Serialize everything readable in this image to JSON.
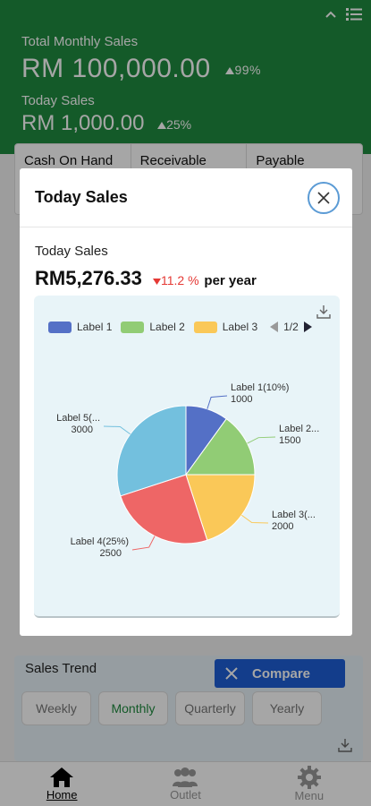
{
  "header": {
    "total_label": "Total Monthly Sales",
    "total_value": "RM 100,000.00",
    "total_delta": "99%",
    "today_label": "Today Sales",
    "today_value": "RM 1,000.00",
    "today_delta": "25%",
    "icons": [
      "chevron-up-icon",
      "menu-list-icon"
    ]
  },
  "stats": {
    "cash_on_hand": "Cash On Hand",
    "receivable": "Receivable",
    "payable": "Payable"
  },
  "modal": {
    "title": "Today Sales",
    "subtitle": "Today Sales",
    "amount": "RM5,276.33",
    "change": "11.2 %",
    "change_suffix": "per year",
    "legend_page": "1/2"
  },
  "chart_data": {
    "type": "pie",
    "title": "",
    "slices": [
      {
        "label": "Label 1",
        "display": "Label 1(10%)",
        "value": 1000,
        "color": "#5470c6"
      },
      {
        "label": "Label 2",
        "display": "Label 2...",
        "value": 1500,
        "color": "#91cc75"
      },
      {
        "label": "Label 3",
        "display": "Label 3(...",
        "value": 2000,
        "color": "#fac858"
      },
      {
        "label": "Label 4",
        "display": "Label 4(25%)",
        "value": 2500,
        "color": "#ee6666"
      },
      {
        "label": "Label 5",
        "display": "Label 5(...",
        "value": 3000,
        "color": "#73c0de"
      }
    ],
    "legend": [
      "Label 1",
      "Label 2",
      "Label 3"
    ],
    "legend_position": "top"
  },
  "trend": {
    "title": "Sales Trend",
    "compare_label": "Compare",
    "periods": [
      "Weekly",
      "Monthly",
      "Quarterly",
      "Yearly"
    ],
    "active_period": "Monthly"
  },
  "nav": {
    "items": [
      "Home",
      "Outlet",
      "Menu"
    ],
    "active": "Home"
  },
  "colors": {
    "header_green": "#1f8a3f",
    "compare_blue": "#1e5fd6",
    "negative_red": "#e53935"
  }
}
